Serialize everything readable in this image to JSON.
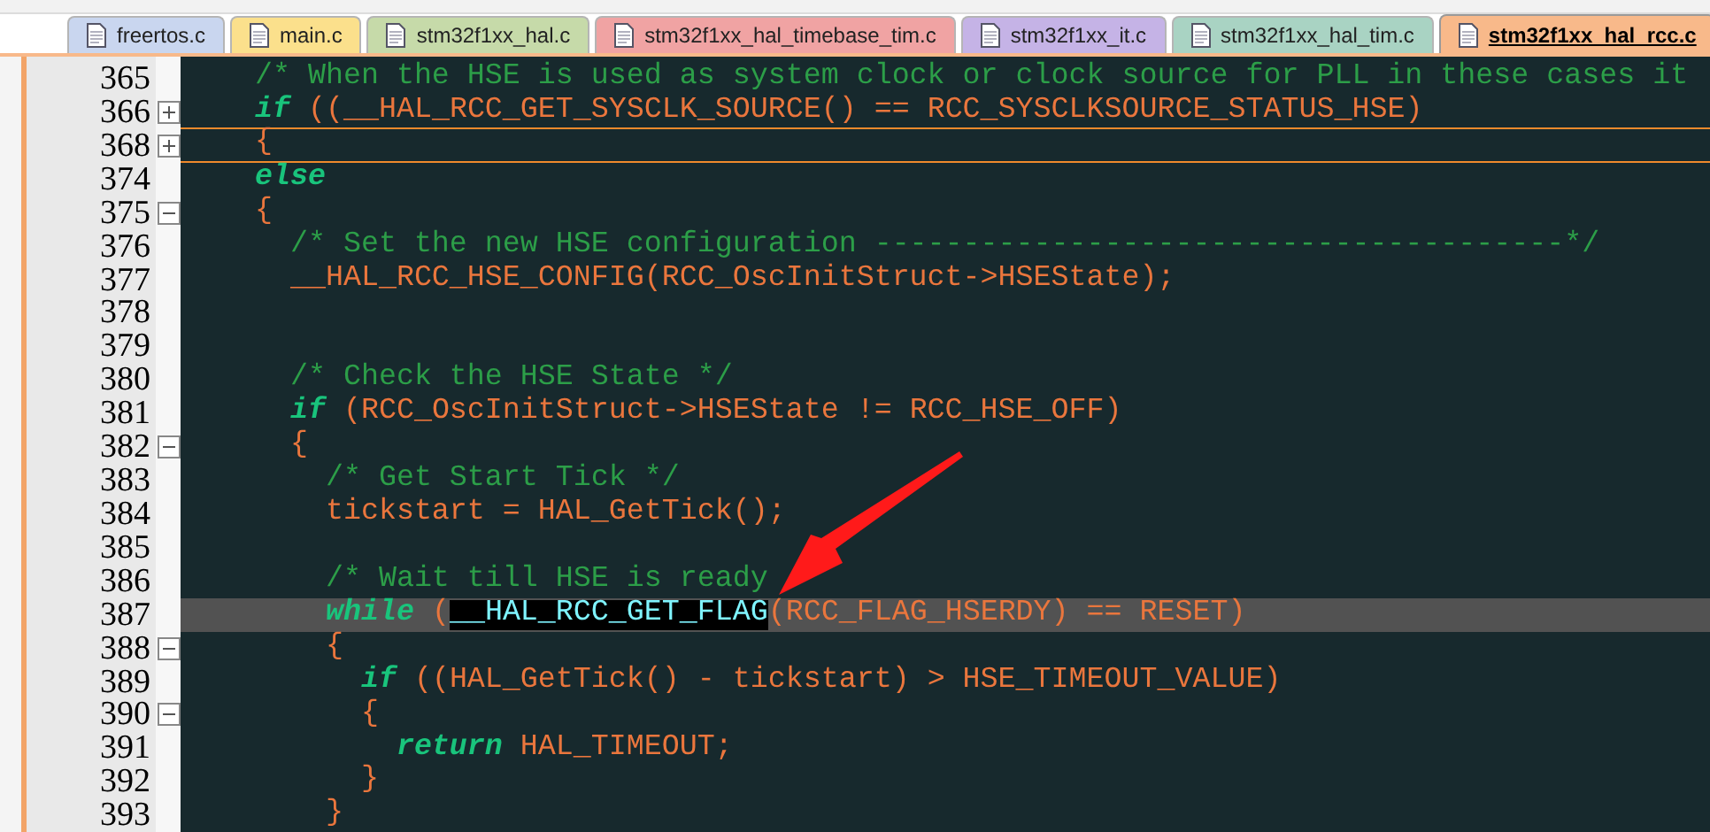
{
  "tabs": [
    {
      "label": "freertos.c",
      "color": "#c9d6ef",
      "selected": false
    },
    {
      "label": "main.c",
      "color": "#fbe08c",
      "selected": false
    },
    {
      "label": "stm32f1xx_hal.c",
      "color": "#c6daa9",
      "selected": false
    },
    {
      "label": "stm32f1xx_hal_timebase_tim.c",
      "color": "#f0a3a3",
      "selected": false
    },
    {
      "label": "stm32f1xx_it.c",
      "color": "#c5b3e6",
      "selected": false
    },
    {
      "label": "stm32f1xx_hal_tim.c",
      "color": "#a9d3c3",
      "selected": false
    },
    {
      "label": "stm32f1xx_hal_rcc.c",
      "color": "#f8b98a",
      "selected": true
    }
  ],
  "editor": {
    "lines": [
      {
        "number": "365",
        "current": false,
        "tokens": [
          {
            "kind": "comment",
            "text": "    /* When the HSE is used as system clock or clock source for PLL in these cases it"
          }
        ]
      },
      {
        "number": "366",
        "current": false,
        "expanded": false,
        "tokens": [
          {
            "kind": "keyword",
            "text": "    if"
          },
          {
            "kind": "code",
            "text": " ((__HAL_RCC_GET_SYSCLK_SOURCE() == RCC_SYSCLKSOURCE_STATUS_HSE)"
          }
        ]
      },
      {
        "number": "368",
        "current": false,
        "expanded": false,
        "tokens": [
          {
            "kind": "code",
            "text": "    {"
          }
        ]
      },
      {
        "number": "374",
        "current": false,
        "tokens": [
          {
            "kind": "keyword",
            "text": "    else"
          }
        ]
      },
      {
        "number": "375",
        "current": false,
        "expanded": true,
        "tokens": [
          {
            "kind": "code",
            "text": "    {"
          }
        ]
      },
      {
        "number": "376",
        "current": false,
        "tokens": [
          {
            "kind": "comment",
            "text": "      /* Set the new HSE configuration ---------------------------------------*/"
          }
        ]
      },
      {
        "number": "377",
        "current": false,
        "tokens": [
          {
            "kind": "code",
            "text": "      __HAL_RCC_HSE_CONFIG(RCC_OscInitStruct->HSEState);"
          }
        ]
      },
      {
        "number": "378",
        "current": false
      },
      {
        "number": "379",
        "current": false
      },
      {
        "number": "380",
        "current": false,
        "tokens": [
          {
            "kind": "comment",
            "text": "      /* Check the HSE State */"
          }
        ]
      },
      {
        "number": "381",
        "current": false,
        "tokens": [
          {
            "kind": "keyword",
            "text": "      if"
          },
          {
            "kind": "code",
            "text": " (RCC_OscInitStruct->HSEState != RCC_HSE_OFF)"
          }
        ]
      },
      {
        "number": "382",
        "current": false,
        "expanded": true,
        "tokens": [
          {
            "kind": "code",
            "text": "      {"
          }
        ]
      },
      {
        "number": "383",
        "current": false,
        "tokens": [
          {
            "kind": "comment",
            "text": "        /* Get Start Tick */"
          }
        ]
      },
      {
        "number": "384",
        "current": false,
        "tokens": [
          {
            "kind": "code",
            "text": "        tickstart = HAL_GetTick();"
          }
        ]
      },
      {
        "number": "385",
        "current": false
      },
      {
        "number": "386",
        "current": false,
        "tokens": [
          {
            "kind": "comment",
            "text": "        /* Wait till HSE is ready"
          }
        ]
      },
      {
        "number": "387",
        "current": true,
        "tokens": [
          {
            "kind": "keyword",
            "text": "        while"
          },
          {
            "kind": "code",
            "text": " ("
          },
          {
            "kind": "selected",
            "text": "__HAL_RCC_GET_FLAG"
          },
          {
            "kind": "code",
            "text": "(RCC_FLAG_HSERDY) == RESET)"
          }
        ]
      },
      {
        "number": "388",
        "current": false,
        "expanded": true,
        "tokens": [
          {
            "kind": "code",
            "text": "        {"
          }
        ]
      },
      {
        "number": "389",
        "current": false,
        "tokens": [
          {
            "kind": "keyword",
            "text": "          if"
          },
          {
            "kind": "code",
            "text": " ((HAL_GetTick() - tickstart) > HSE_TIMEOUT_VALUE)"
          }
        ]
      },
      {
        "number": "390",
        "current": false,
        "expanded": true,
        "tokens": [
          {
            "kind": "code",
            "text": "          {"
          }
        ]
      },
      {
        "number": "391",
        "current": false,
        "tokens": [
          {
            "kind": "keyword",
            "text": "            return"
          },
          {
            "kind": "code",
            "text": " HAL_TIMEOUT;"
          }
        ]
      },
      {
        "number": "392",
        "current": false,
        "tokens": [
          {
            "kind": "code",
            "text": "          }"
          }
        ]
      },
      {
        "number": "393",
        "current": false,
        "tokens": [
          {
            "kind": "code",
            "text": "        }"
          }
        ]
      }
    ]
  }
}
